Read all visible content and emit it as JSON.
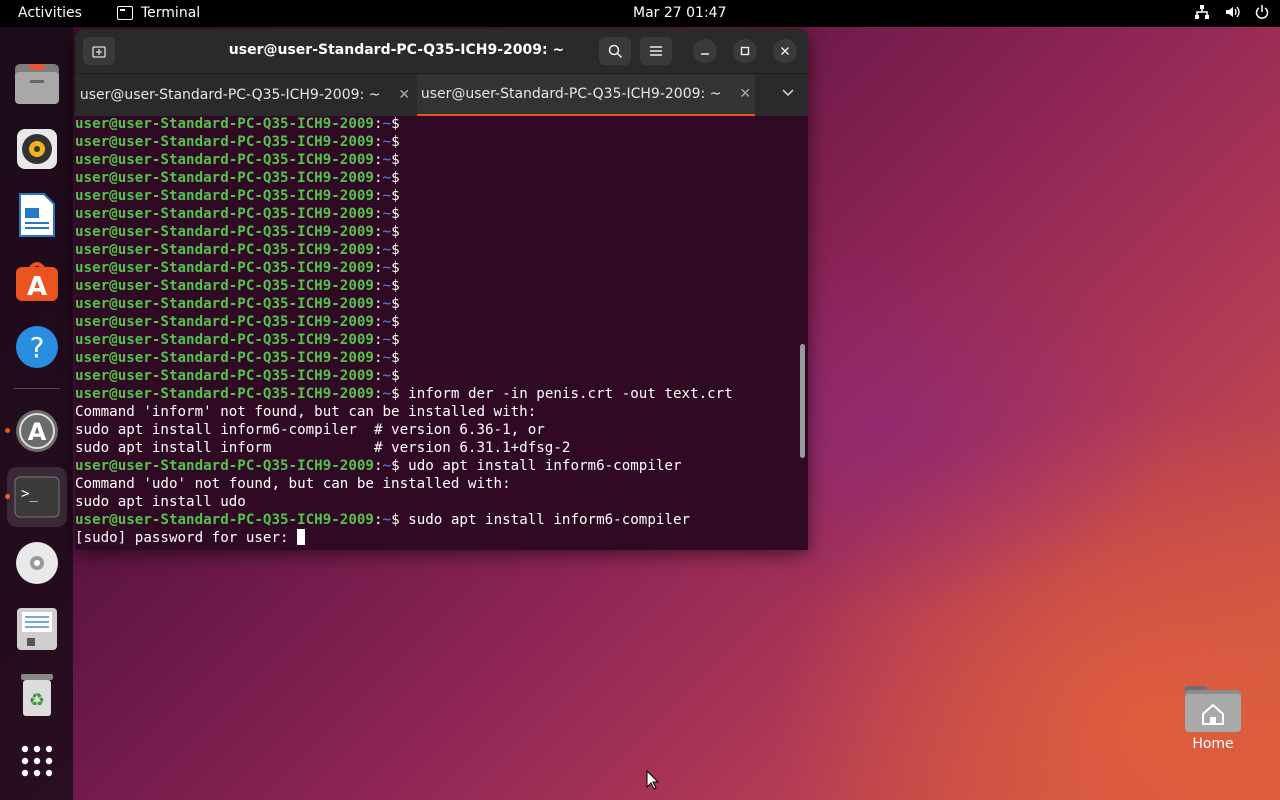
{
  "topbar": {
    "activities": "Activities",
    "app_name": "Terminal",
    "clock": "Mar 27  01:47"
  },
  "dock": {
    "items": [
      "files-icon",
      "rhythmbox-icon",
      "libreoffice-writer-icon",
      "app-center-icon",
      "help-icon",
      "software-updater-icon",
      "terminal-icon",
      "dvd-icon",
      "floppy-save-icon",
      "trash-icon",
      "show-apps-icon"
    ]
  },
  "window": {
    "title": "user@user-Standard-PC-Q35-ICH9-2009: ~",
    "tabs": [
      {
        "label": "user@user-Standard-PC-Q35-ICH9-2009: ~",
        "selected": false
      },
      {
        "label": "user@user-Standard-PC-Q35-ICH9-2009: ~",
        "selected": true
      }
    ]
  },
  "terminal": {
    "prompt_user": "user@user-Standard-PC-Q35-ICH9-2009",
    "prompt_path": "~",
    "lines": [
      {
        "type": "prompt",
        "cmd": ""
      },
      {
        "type": "prompt",
        "cmd": ""
      },
      {
        "type": "prompt",
        "cmd": ""
      },
      {
        "type": "prompt",
        "cmd": ""
      },
      {
        "type": "prompt",
        "cmd": ""
      },
      {
        "type": "prompt",
        "cmd": ""
      },
      {
        "type": "prompt",
        "cmd": ""
      },
      {
        "type": "prompt",
        "cmd": ""
      },
      {
        "type": "prompt",
        "cmd": ""
      },
      {
        "type": "prompt",
        "cmd": ""
      },
      {
        "type": "prompt",
        "cmd": ""
      },
      {
        "type": "prompt",
        "cmd": ""
      },
      {
        "type": "prompt",
        "cmd": ""
      },
      {
        "type": "prompt",
        "cmd": ""
      },
      {
        "type": "prompt",
        "cmd": ""
      },
      {
        "type": "prompt",
        "cmd": " inform der -in penis.crt -out text.crt"
      },
      {
        "type": "text",
        "text": "Command 'inform' not found, but can be installed with:"
      },
      {
        "type": "text",
        "text": "sudo apt install inform6-compiler  # version 6.36-1, or"
      },
      {
        "type": "text",
        "text": "sudo apt install inform            # version 6.31.1+dfsg-2"
      },
      {
        "type": "prompt",
        "cmd": " udo apt install inform6-compiler"
      },
      {
        "type": "text",
        "text": "Command 'udo' not found, but can be installed with:"
      },
      {
        "type": "text",
        "text": "sudo apt install udo"
      },
      {
        "type": "prompt",
        "cmd": " sudo apt install inform6-compiler"
      },
      {
        "type": "text",
        "text": "[sudo] password for user: ",
        "cursor": true
      }
    ]
  },
  "desktop": {
    "home_label": "Home"
  }
}
